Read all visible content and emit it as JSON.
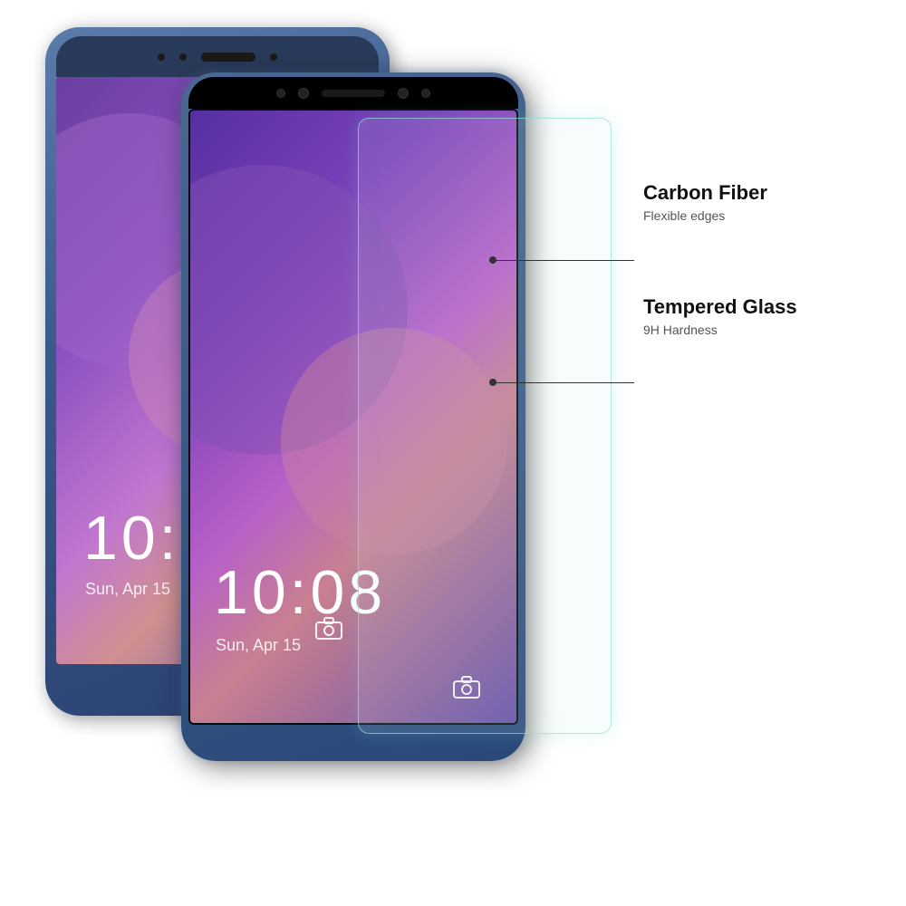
{
  "scene": {
    "background": "#ffffff"
  },
  "labels": {
    "carbon_fiber": {
      "title": "Carbon Fiber",
      "subtitle": "Flexible edges"
    },
    "tempered_glass": {
      "title": "Tempered Glass",
      "subtitle": "9H Hardness"
    }
  },
  "phone": {
    "time": "10:08",
    "date": "Sun, Apr 15",
    "status_icon": "camera"
  }
}
